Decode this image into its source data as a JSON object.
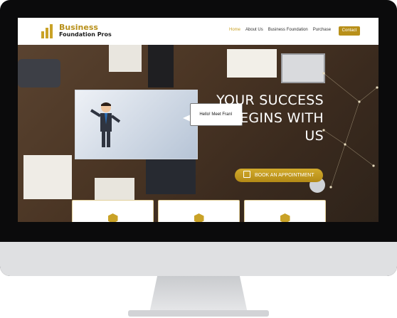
{
  "site": {
    "logo": {
      "line1": "Business",
      "line2": "Foundation Pros"
    },
    "nav": {
      "items": [
        {
          "label": "Home",
          "active": true
        },
        {
          "label": "About Us",
          "active": false
        },
        {
          "label": "Business Foundation",
          "active": false
        },
        {
          "label": "Purchase",
          "active": false
        }
      ],
      "contact_label": "Contact"
    },
    "hero": {
      "video_speech": "Hello! Meet Frank",
      "headline_line1": "YOUR SUCCESS",
      "headline_line2": "BEGINS WITH",
      "headline_line3": "US",
      "cta_label": "BOOK AN APPOINTMENT"
    },
    "colors": {
      "accent": "#c9a227",
      "accent_dark": "#b8901a"
    },
    "icons": [
      "bar-chart-logo-icon",
      "calendar-icon",
      "feature-badge-icon"
    ]
  }
}
